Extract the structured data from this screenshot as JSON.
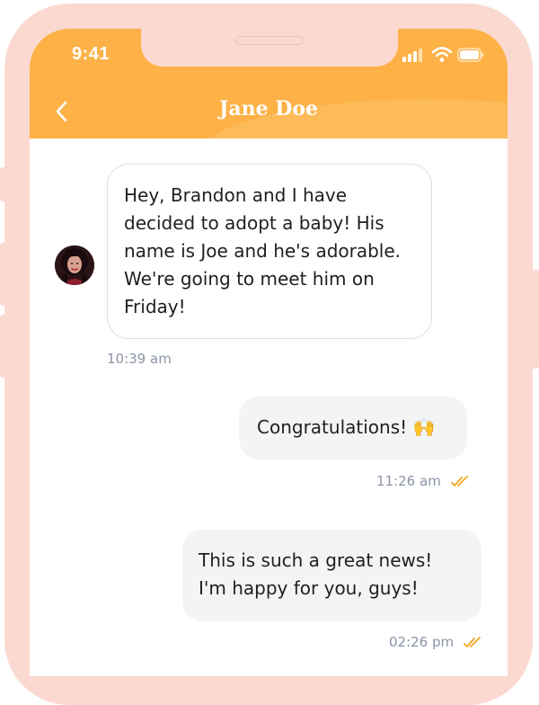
{
  "status_bar": {
    "time": "9:41"
  },
  "header": {
    "title": "Jane Doe"
  },
  "messages": [
    {
      "direction": "incoming",
      "text": "Hey, Brandon and I have decided to adopt a baby! His name is Joe and he's adorable. We're going to meet him on Friday!",
      "time": "10:39 am"
    },
    {
      "direction": "outgoing",
      "text": "Congratulations!",
      "emoji": "🙌",
      "time": "11:26 am"
    },
    {
      "direction": "outgoing",
      "text": "This is such a great news! I'm happy for you, guys!",
      "time": "02:26 pm"
    }
  ],
  "colors": {
    "header": "#fdb146",
    "frame": "#fbd9d0",
    "outgoing_bubble": "#f3f4f6",
    "read_check": "#f5a623",
    "timestamp": "#8a94a6"
  },
  "icons": [
    "back-chevron-icon",
    "signal-icon",
    "wifi-icon",
    "battery-icon",
    "double-check-icon",
    "raising-hands-emoji"
  ]
}
